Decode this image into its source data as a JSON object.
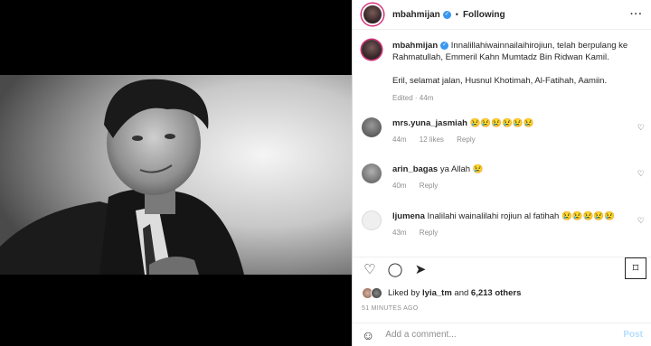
{
  "post": {
    "image_alt": "black and white portrait of a young man in a suit"
  },
  "header": {
    "username": "mbahmijan",
    "verified_icon": "verified-badge-icon",
    "dot": "•",
    "follow_label": "Following",
    "more_icon": "more-options-icon"
  },
  "caption": {
    "username": "mbahmijan",
    "text1": "Innalillahiwainnailaihirojiun, telah berpulang ke Rahmatullah, Emmeril Kahn Mumtadz Bin Ridwan Kamil.",
    "text2": "Eril, selamat jalan, Husnul Khotimah, Al-Fatihah, Aamiin.",
    "meta": "Edited · 44m"
  },
  "comments": [
    {
      "username": "mrs.yuna_jasmiah",
      "text": "😢😢😢😢😢😢",
      "time": "44m",
      "likes": "12 likes",
      "reply": "Reply"
    },
    {
      "username": "arin_bagas",
      "text": "ya Allah 😢",
      "time": "40m",
      "likes": "",
      "reply": "Reply"
    },
    {
      "username": "ljumena",
      "text": "Inalilahi wainalilahi rojiun al fatihah 😢😢😢😢😢",
      "time": "43m",
      "likes": "",
      "reply": "Reply"
    }
  ],
  "actions": {
    "like_icon": "heart-icon",
    "comment_icon": "comment-icon",
    "share_icon": "share-icon",
    "save_icon": "bookmark-icon"
  },
  "likes": {
    "liked_by": "Liked by",
    "user": "lyia_tm",
    "and": "and",
    "count": "6,213 others"
  },
  "timestamp": "51 MINUTES AGO",
  "add_comment": {
    "emoji_icon": "emoji-icon",
    "placeholder": "Add a comment...",
    "post_label": "Post"
  },
  "colors": {
    "accent_link": "#b2dffc",
    "verified": "#3897f0",
    "muted": "#8e8e8e"
  }
}
